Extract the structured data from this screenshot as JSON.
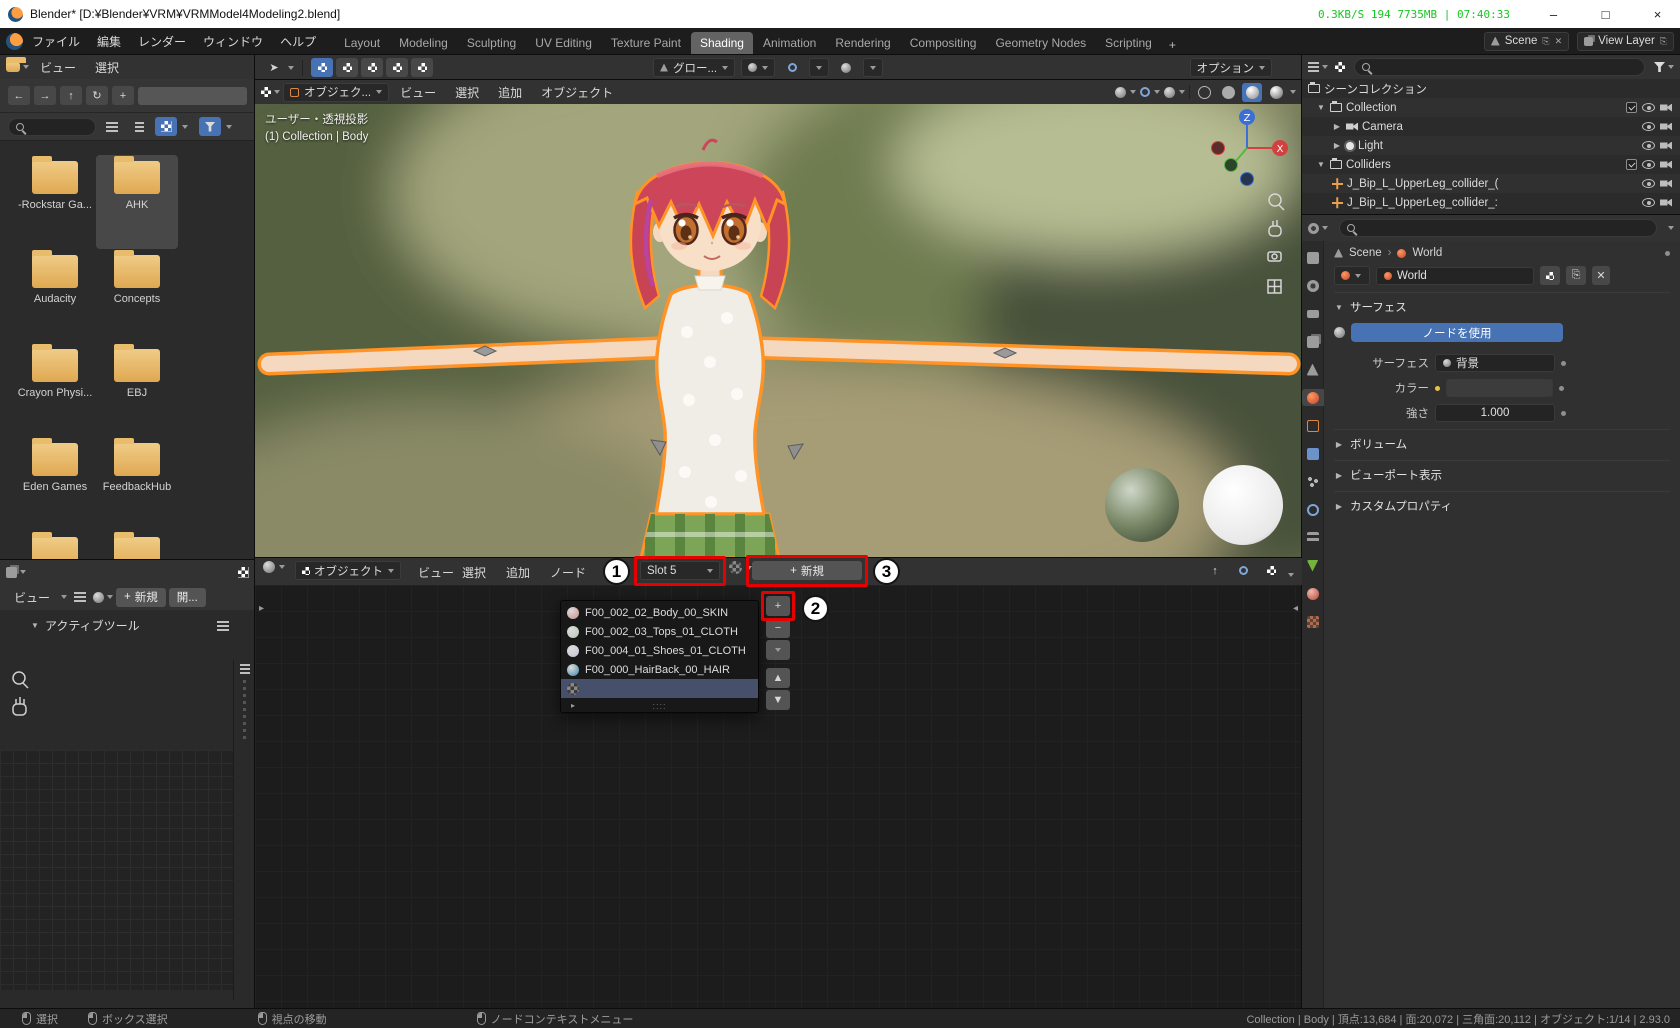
{
  "titlebar": {
    "app_title": "Blender* [D:¥Blender¥VRM¥VRMModel4Modeling2.blend]",
    "net_stats": "0.3KB/S 194 7735MB | 07:40:33"
  },
  "menubar": {
    "menus": [
      {
        "label": "ファイル"
      },
      {
        "label": "編集"
      },
      {
        "label": "レンダー"
      },
      {
        "label": "ウィンドウ"
      },
      {
        "label": "ヘルプ"
      }
    ],
    "workspaces": [
      {
        "label": "Layout"
      },
      {
        "label": "Modeling"
      },
      {
        "label": "Sculpting"
      },
      {
        "label": "UV Editing"
      },
      {
        "label": "Texture Paint"
      },
      {
        "label": "Shading"
      },
      {
        "label": "Animation"
      },
      {
        "label": "Rendering"
      },
      {
        "label": "Compositing"
      },
      {
        "label": "Geometry Nodes"
      },
      {
        "label": "Scripting"
      }
    ],
    "add_workspace": "+",
    "scene_selector": {
      "value": "Scene"
    },
    "view_layer_selector": {
      "value": "View Layer"
    }
  },
  "file_browser": {
    "menus": [
      {
        "label": "ビュー"
      },
      {
        "label": "選択"
      }
    ],
    "folders": [
      {
        "name": "-Rockstar Ga..."
      },
      {
        "name": "AHK"
      },
      {
        "name": "Audacity"
      },
      {
        "name": "Concepts"
      },
      {
        "name": "Crayon Physi..."
      },
      {
        "name": "EBJ"
      },
      {
        "name": "Eden Games"
      },
      {
        "name": "FeedbackHub"
      }
    ],
    "selected_folder": "AHK"
  },
  "image_editor": {
    "view_menu": "ビュー",
    "new_button": "新規",
    "open_button": "開...",
    "panel_title": "アクティブツール"
  },
  "tool_settings": {
    "orientation": "グロー...",
    "options": "オプション"
  },
  "viewport": {
    "mode": "オブジェク...",
    "menus": [
      {
        "label": "ビュー"
      },
      {
        "label": "選択"
      },
      {
        "label": "追加"
      },
      {
        "label": "オブジェクト"
      }
    ],
    "overlay_line1": "ユーザー・透視投影",
    "overlay_line2": "(1) Collection | Body",
    "gizmo": {
      "z": "Z",
      "x": "X"
    }
  },
  "shader_editor": {
    "shader_type": "オブジェクト",
    "menus": [
      {
        "label": "ビュー"
      },
      {
        "label": "選択"
      },
      {
        "label": "追加"
      },
      {
        "label": "ノード"
      }
    ],
    "slot": "Slot 5",
    "new_material": "新規",
    "materials": [
      {
        "name": "F00_002_02_Body_00_SKIN",
        "color": "#c98f85"
      },
      {
        "name": "F00_002_03_Tops_01_CLOTH",
        "color": "#b9c9b4"
      },
      {
        "name": "F00_004_01_Shoes_01_CLOTH",
        "color": "#c4c4d6"
      },
      {
        "name": "F00_000_HairBack_00_HAIR",
        "color": "#3e87a8"
      }
    ],
    "annotations": {
      "slot": "1",
      "add": "2",
      "new": "3"
    }
  },
  "outliner": {
    "scene_collection": "シーンコレクション",
    "items": [
      {
        "label": "Collection"
      },
      {
        "label": "Camera"
      },
      {
        "label": "Light"
      },
      {
        "label": "Colliders"
      },
      {
        "label": "J_Bip_L_UpperLeg_collider_("
      },
      {
        "label": "J_Bip_L_UpperLeg_collider_:"
      }
    ]
  },
  "properties": {
    "breadcrumb": {
      "scene": "Scene",
      "world": "World"
    },
    "world_name": "World",
    "surface_panel": "サーフェス",
    "use_nodes": "ノードを使用",
    "rows": {
      "surface_label": "サーフェス",
      "surface_value": "背景",
      "color_label": "カラー",
      "strength_label": "強さ",
      "strength_value": "1.000"
    },
    "collapsed": [
      {
        "label": "ボリューム"
      },
      {
        "label": "ビューポート表示"
      },
      {
        "label": "カスタムプロパティ"
      }
    ]
  },
  "statusbar": {
    "items": [
      {
        "label": "選択"
      },
      {
        "label": "ボックス選択"
      },
      {
        "label": "視点の移動"
      },
      {
        "label": "ノードコンテキストメニュー"
      }
    ],
    "stats": "Collection | Body | 頂点:13,684 | 面:20,072 | 三角面:20,112 | オブジェクト:1/14 | 2.93.0"
  },
  "colors": {
    "accent": "#4772b3",
    "annotation_red": "#e60000",
    "selection_outline": "#ff9326"
  }
}
